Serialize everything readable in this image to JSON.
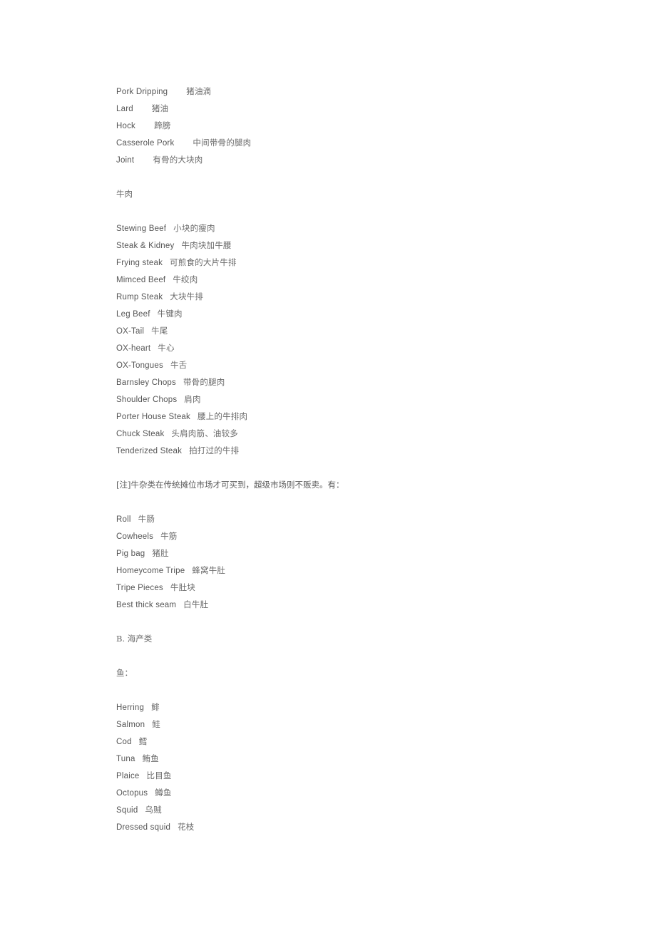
{
  "document": {
    "blocks": [
      {
        "kind": "entry",
        "en": "Pork  Dripping",
        "zh": "猪油滴",
        "gap": "wide"
      },
      {
        "kind": "entry",
        "en": "Lard",
        "zh": "猪油",
        "gap": "wide"
      },
      {
        "kind": "entry",
        "en": "Hock",
        "zh": "蹄膀",
        "gap": "wide"
      },
      {
        "kind": "entry",
        "en": "Casserole  Pork",
        "zh": "中间带骨的腿肉",
        "gap": "wide"
      },
      {
        "kind": "entry",
        "en": "Joint",
        "zh": "有骨的大块肉",
        "gap": "wide"
      },
      {
        "kind": "spacer"
      },
      {
        "kind": "heading",
        "text": "牛肉"
      },
      {
        "kind": "spacer"
      },
      {
        "kind": "entry",
        "en": "Stewing  Beef",
        "zh": "小块的瘦肉",
        "gap": "normal"
      },
      {
        "kind": "entry",
        "en": "Steak  &  Kidney",
        "zh": "牛肉块加牛腰",
        "gap": "normal"
      },
      {
        "kind": "entry",
        "en": "Frying  steak",
        "zh": "可煎食的大片牛排",
        "gap": "normal"
      },
      {
        "kind": "entry",
        "en": "Mimced  Beef",
        "zh": "牛绞肉",
        "gap": "normal"
      },
      {
        "kind": "entry",
        "en": "Rump  Steak",
        "zh": "大块牛排",
        "gap": "normal"
      },
      {
        "kind": "entry",
        "en": "Leg  Beef",
        "zh": "牛键肉",
        "gap": "normal"
      },
      {
        "kind": "entry",
        "en": "OX-Tail",
        "zh": "牛尾",
        "gap": "normal"
      },
      {
        "kind": "entry",
        "en": "OX-heart",
        "zh": "牛心",
        "gap": "normal"
      },
      {
        "kind": "entry",
        "en": "OX-Tongues",
        "zh": "牛舌",
        "gap": "normal"
      },
      {
        "kind": "entry",
        "en": "Barnsley  Chops",
        "zh": "带骨的腿肉",
        "gap": "normal"
      },
      {
        "kind": "entry",
        "en": "Shoulder  Chops",
        "zh": "肩肉",
        "gap": "normal"
      },
      {
        "kind": "entry",
        "en": "Porter  House  Steak",
        "zh": "腰上的牛排肉",
        "gap": "normal"
      },
      {
        "kind": "entry",
        "en": "Chuck  Steak",
        "zh": "头肩肉筋、油较多",
        "gap": "normal"
      },
      {
        "kind": "entry",
        "en": "Tenderized  Steak",
        "zh": "拍打过的牛排",
        "gap": "normal"
      },
      {
        "kind": "spacer"
      },
      {
        "kind": "note",
        "text": "[注]牛杂类在传统摊位市场才可买到，超级市场则不贩卖。有："
      },
      {
        "kind": "spacer"
      },
      {
        "kind": "entry",
        "en": "Roll",
        "zh": "牛肠",
        "gap": "normal"
      },
      {
        "kind": "entry",
        "en": "Cowheels",
        "zh": "牛筋",
        "gap": "normal"
      },
      {
        "kind": "entry",
        "en": "Pig  bag",
        "zh": "猪肚",
        "gap": "normal"
      },
      {
        "kind": "entry",
        "en": "Homeycome  Tripe",
        "zh": "蜂窝牛肚",
        "gap": "normal"
      },
      {
        "kind": "entry",
        "en": "Tripe  Pieces",
        "zh": "牛肚块",
        "gap": "normal"
      },
      {
        "kind": "entry",
        "en": "Best  thick  seam",
        "zh": "白牛肚",
        "gap": "normal"
      },
      {
        "kind": "spacer"
      },
      {
        "kind": "heading",
        "text": "B.  海产类"
      },
      {
        "kind": "spacer"
      },
      {
        "kind": "heading",
        "text": "鱼："
      },
      {
        "kind": "spacer"
      },
      {
        "kind": "entry",
        "en": "Herring",
        "zh": "鲱",
        "gap": "normal"
      },
      {
        "kind": "entry",
        "en": "Salmon",
        "zh": "鲑",
        "gap": "normal"
      },
      {
        "kind": "entry",
        "en": "Cod",
        "zh": "鳕",
        "gap": "normal"
      },
      {
        "kind": "entry",
        "en": "Tuna",
        "zh": "鲔鱼",
        "gap": "normal"
      },
      {
        "kind": "entry",
        "en": "Plaice",
        "zh": "比目鱼",
        "gap": "normal"
      },
      {
        "kind": "entry",
        "en": "Octopus",
        "zh": "鳟鱼",
        "gap": "normal"
      },
      {
        "kind": "entry",
        "en": "Squid",
        "zh": "乌贼",
        "gap": "normal"
      },
      {
        "kind": "entry",
        "en": "Dressed  squid",
        "zh": "花枝",
        "gap": "normal"
      }
    ]
  }
}
